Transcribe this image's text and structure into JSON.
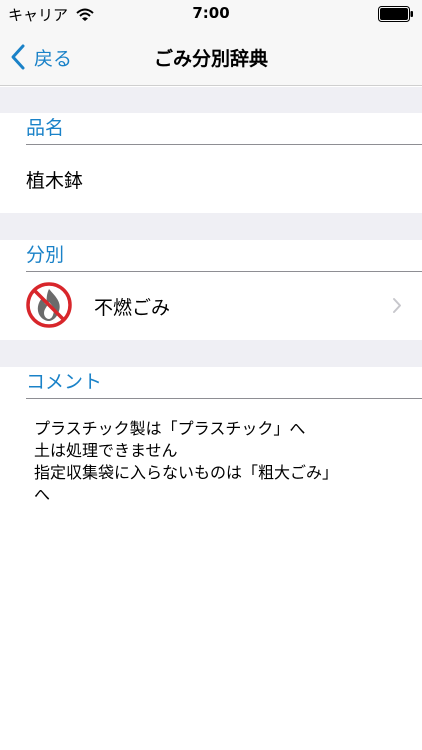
{
  "status_bar": {
    "carrier": "キャリア",
    "time": "7:00"
  },
  "nav": {
    "back_label": "戻る",
    "title": "ごみ分別辞典"
  },
  "sections": {
    "name": {
      "header": "品名",
      "value": "植木鉢"
    },
    "category": {
      "header": "分別",
      "value": "不燃ごみ",
      "icon": "no-burn-icon"
    },
    "comment": {
      "header": "コメント",
      "lines": [
        "プラスチック製は「プラスチック」へ",
        "土は処理できません",
        "指定収集袋に入らないものは「粗大ごみ」",
        "へ"
      ]
    }
  },
  "colors": {
    "accent": "#1a82c8",
    "group_background": "#efeff4",
    "bar_background": "#f7f7f7"
  }
}
